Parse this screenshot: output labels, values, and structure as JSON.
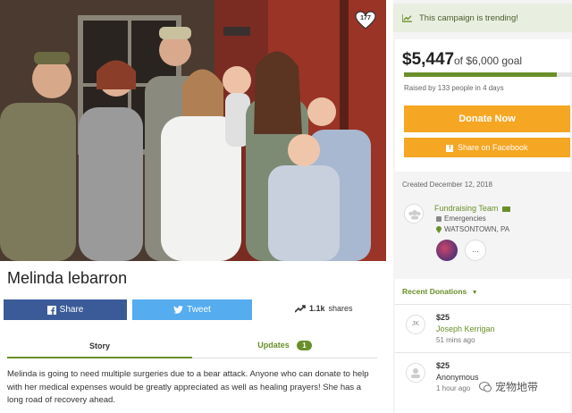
{
  "campaign": {
    "heart_count": "177",
    "title": "Melinda lebarron",
    "share_label": "Share",
    "tweet_label": "Tweet",
    "shares_count": "1.1k",
    "shares_label": "shares",
    "tabs": {
      "story": "Story",
      "updates": "Updates",
      "updates_count": "1"
    },
    "story_text": "Melinda is going to need multiple surgeries due to a bear attack. Anyone who can donate to help with her medical expenses would be greatly appreciated as well as healing prayers! She has a long road of recovery ahead."
  },
  "sidebar": {
    "trending": "This campaign is trending!",
    "raised_amount": "$5,447",
    "goal_text": "of $6,000 goal",
    "progress_fraction": 0.9078,
    "raised_by": "Raised by 133 people in 4 days",
    "donate_label": "Donate Now",
    "fb_share_label": "Share on Facebook",
    "created": "Created December 12, 2018",
    "organizer": {
      "name": "Fundraising Team",
      "category": "Emergencies",
      "location": "WATSONTOWN, PA",
      "more": "..."
    },
    "recent_label": "Recent Donations",
    "donations": [
      {
        "initials": "JK",
        "amount": "$25",
        "name": "Joseph Kerrigan",
        "time": "51 mins ago"
      },
      {
        "initials": "",
        "amount": "$25",
        "name": "Anonymous",
        "time": "1 hour ago"
      }
    ]
  },
  "watermark": "宠物地带",
  "colors": {
    "green": "#6a8f2a",
    "orange": "#f5a623",
    "facebook": "#3b5b98",
    "twitter": "#55acee"
  }
}
